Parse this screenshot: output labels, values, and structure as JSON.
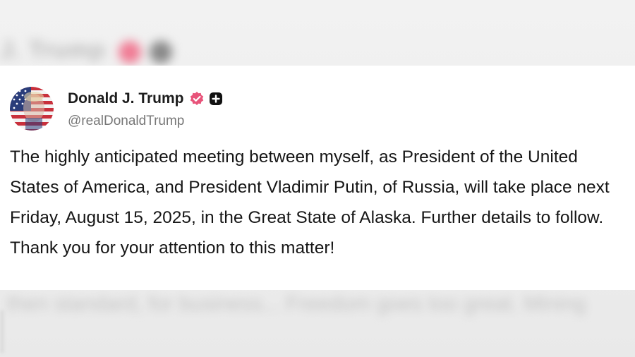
{
  "background": {
    "blurred_header_text": "J. Trump",
    "blurred_footer_text": "then standard, for business... Freedom goes too great. Mining"
  },
  "post": {
    "author": {
      "display_name": "Donald J. Trump",
      "handle": "@realDonaldTrump",
      "avatar_icon": "flag-portrait-avatar",
      "verified_icon": "verified-badge-icon",
      "extra_icon": "plus-square-icon"
    },
    "text": "The highly anticipated meeting between myself, as President of the United States of America, and President Vladimir Putin, of Russia, will take place next Friday, August 15, 2025, in the Great State of Alaska. Further details to follow. Thank you for your attention to this matter!"
  },
  "colors": {
    "verified_badge": "#e8547a",
    "card_background": "#ffffff",
    "page_background": "#ececec"
  }
}
